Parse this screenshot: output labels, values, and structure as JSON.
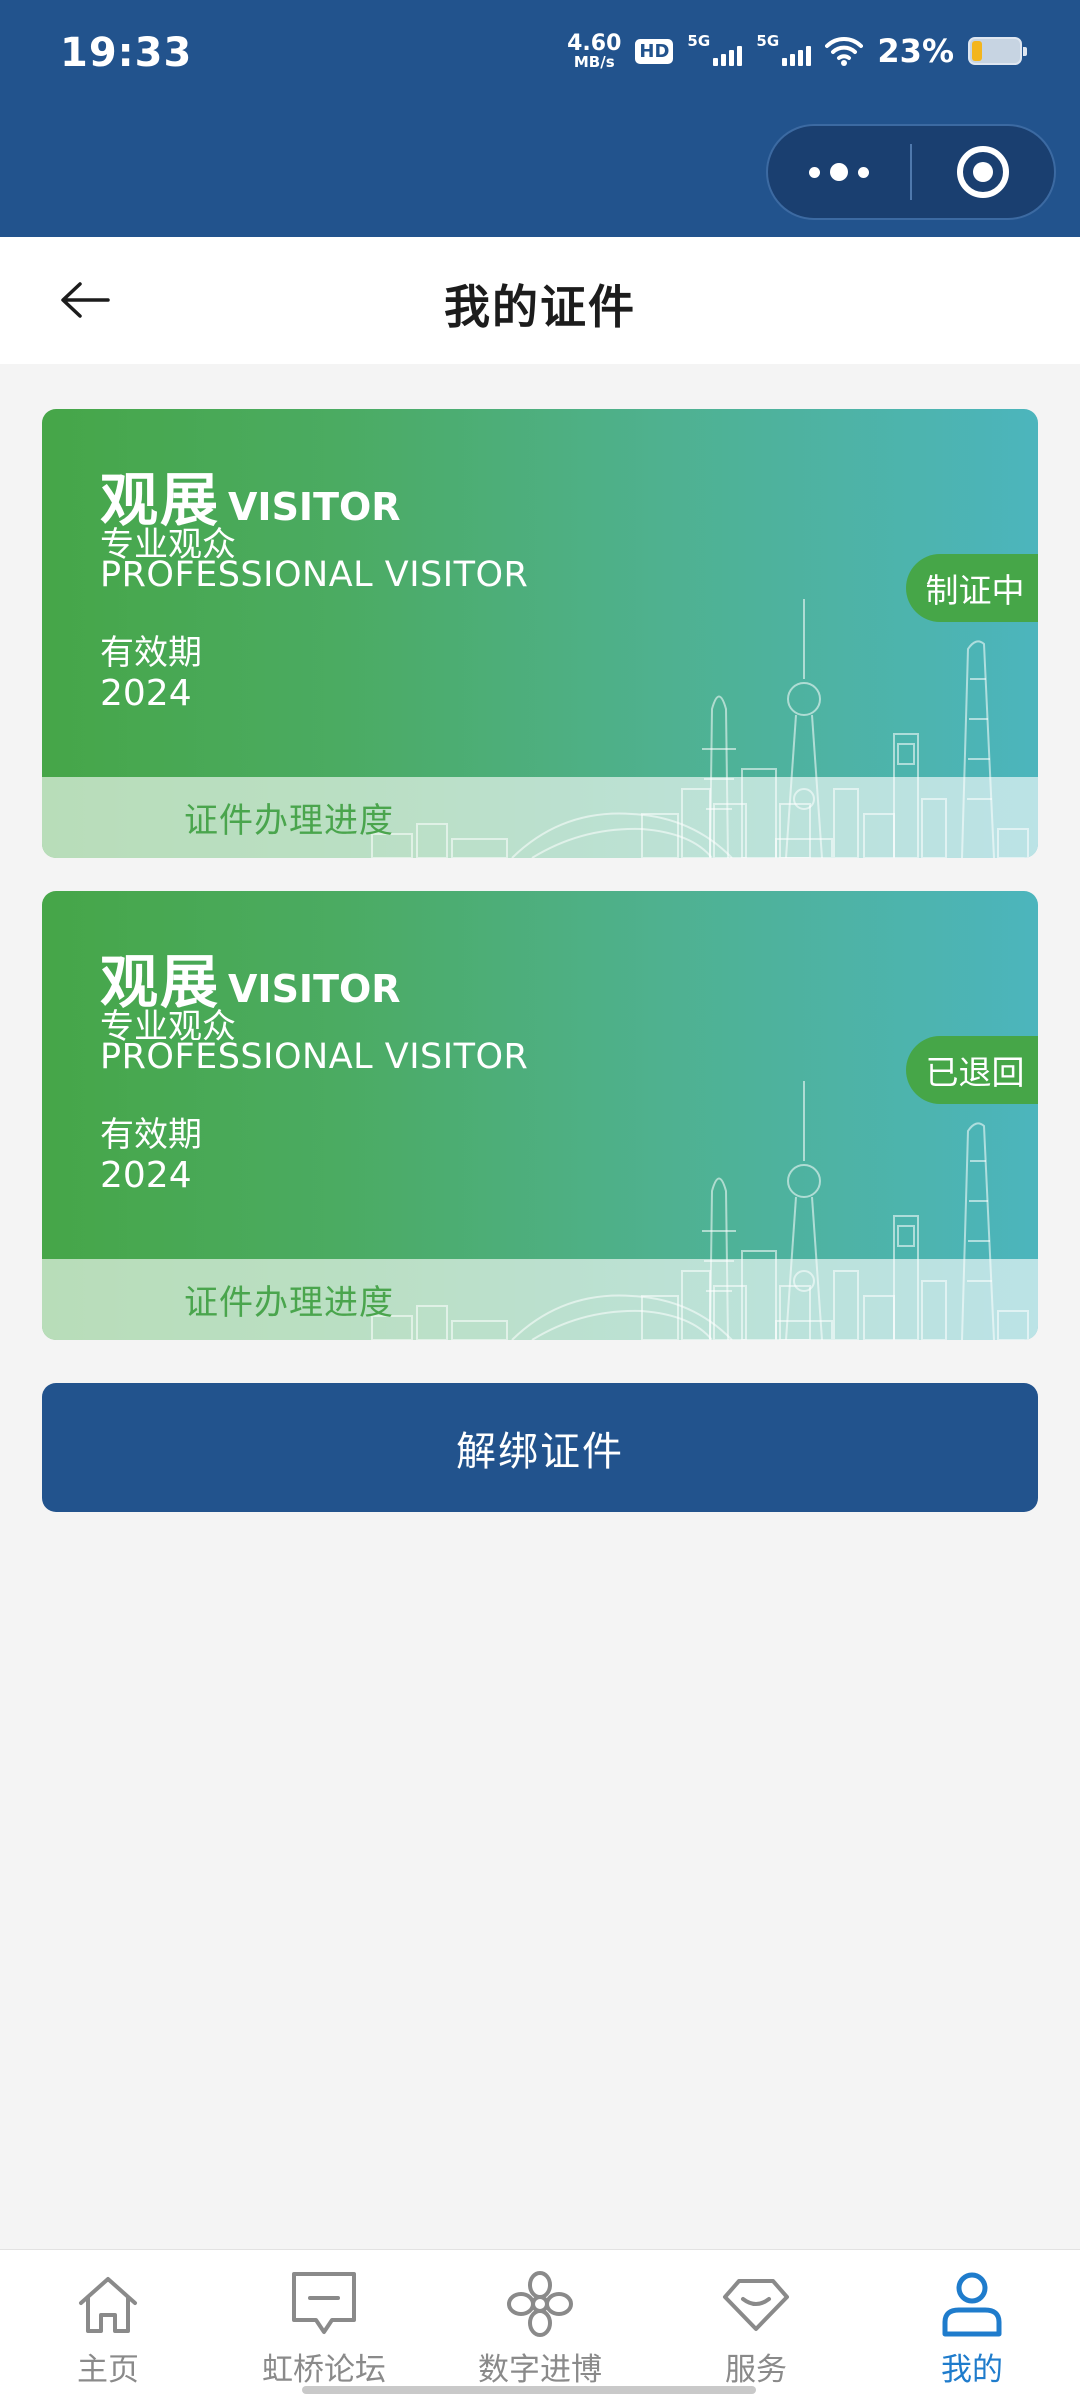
{
  "status_bar": {
    "time": "19:33",
    "net_speed_value": "4.60",
    "net_speed_unit": "MB/s",
    "hd_label": "HD",
    "sim1_label": "5G",
    "sim2_label": "5G",
    "battery_percent": "23%"
  },
  "capsule": {
    "more_icon": "more-dots-icon",
    "close_icon": "target-close-icon"
  },
  "nav": {
    "back_icon": "back-arrow-icon",
    "title": "我的证件"
  },
  "cards": [
    {
      "type_cn": "观展",
      "type_en": "VISITOR",
      "role_cn": "专业观众",
      "role_en": "PROFESSIONAL VISITOR",
      "validity_label": "有效期",
      "validity_year": "2024",
      "status": "制证中",
      "progress_link": "证件办理进度"
    },
    {
      "type_cn": "观展",
      "type_en": "VISITOR",
      "role_cn": "专业观众",
      "role_en": "PROFESSIONAL VISITOR",
      "validity_label": "有效期",
      "validity_year": "2024",
      "status": "已退回",
      "progress_link": "证件办理进度"
    }
  ],
  "unbind_button": "解绑证件",
  "tabs": [
    {
      "label": "主页",
      "icon": "home-icon",
      "active": false
    },
    {
      "label": "虹桥论坛",
      "icon": "message-icon",
      "active": false
    },
    {
      "label": "数字进博",
      "icon": "flower-icon",
      "active": false
    },
    {
      "label": "服务",
      "icon": "diamond-icon",
      "active": false
    },
    {
      "label": "我的",
      "icon": "person-icon",
      "active": true
    }
  ],
  "colors": {
    "header_blue": "#22538d",
    "card_green": "#46a648",
    "card_teal": "#4cb5bd",
    "active_tab": "#1f7ccc"
  }
}
